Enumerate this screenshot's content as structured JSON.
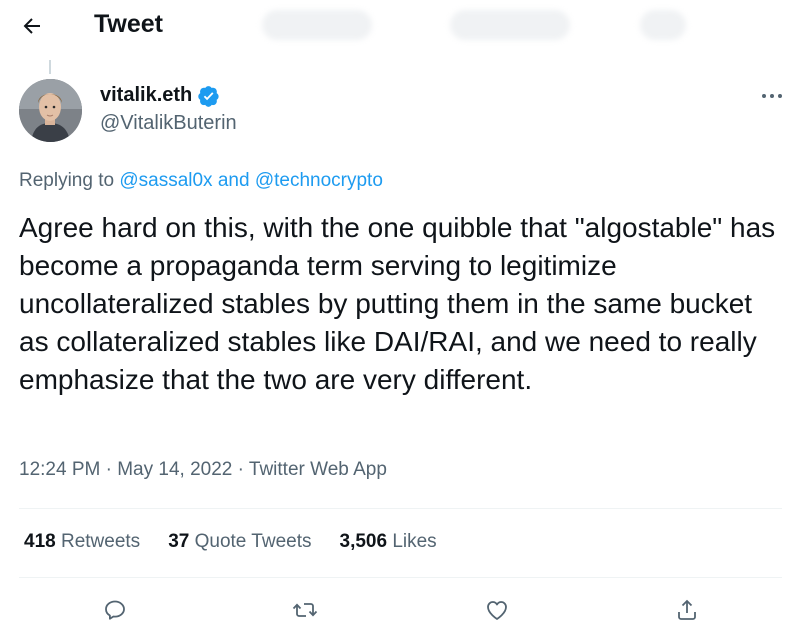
{
  "header": {
    "title": "Tweet",
    "back_icon": "arrow-left-icon"
  },
  "author": {
    "display_name": "vitalik.eth",
    "handle": "@VitalikButerin",
    "verified": true,
    "verified_color": "#1d9bf0"
  },
  "reply": {
    "prefix": "Replying to",
    "mention1": "@sassal0x",
    "conjunction": "and",
    "mention2": "@technocrypto"
  },
  "tweet": {
    "text": "Agree hard on this, with the one quibble that \"algostable\" has become a propaganda term serving to legitimize uncollateralized stables by putting them in the same bucket as collateralized stables like DAI/RAI, and we need to really emphasize that the two are very different.",
    "time": "12:24 PM",
    "date": "May 14, 2022",
    "source": "Twitter Web App",
    "separator": "·"
  },
  "stats": {
    "retweets_count": "418",
    "retweets_label": "Retweets",
    "quote_count": "37",
    "quote_label": "Quote Tweets",
    "likes_count": "3,506",
    "likes_label": "Likes"
  },
  "actions": [
    "reply-icon",
    "retweet-icon",
    "like-icon",
    "share-icon"
  ],
  "colors": {
    "accent": "#1d9bf0",
    "text_primary": "#0f1419",
    "text_secondary": "#536471",
    "divider": "#eff3f4"
  }
}
